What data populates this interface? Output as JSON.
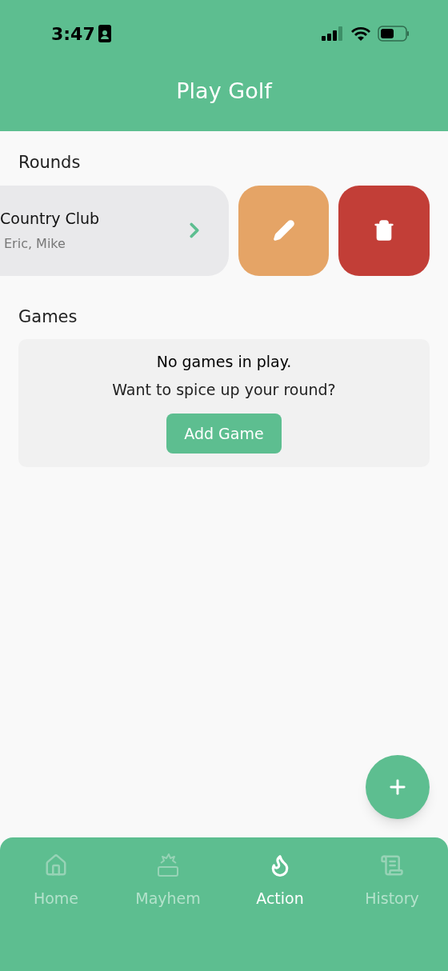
{
  "status_bar": {
    "time": "3:47"
  },
  "header": {
    "title": "Play Golf"
  },
  "rounds": {
    "heading": "Rounds",
    "items": [
      {
        "name": "Country Club",
        "players": "Eric, Mike"
      }
    ]
  },
  "games": {
    "heading": "Games",
    "empty_title": "No games in play.",
    "empty_text": "Want to spice up your round?",
    "button": "Add Game"
  },
  "tabs": [
    {
      "label": "Home",
      "kind": "home",
      "selected": false
    },
    {
      "label": "Mayhem",
      "kind": "mayhem",
      "selected": false
    },
    {
      "label": "Action",
      "kind": "action",
      "selected": true
    },
    {
      "label": "History",
      "kind": "history",
      "selected": false
    }
  ]
}
